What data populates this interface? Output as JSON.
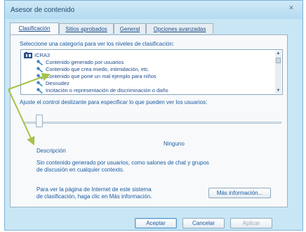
{
  "window": {
    "title": "Asesor de contenido",
    "close_label": "✕"
  },
  "tabs": [
    {
      "label": "Clasificación",
      "active": true
    },
    {
      "label": "Sitios aprobados",
      "active": false
    },
    {
      "label": "General",
      "active": false
    },
    {
      "label": "Opciones avanzadas",
      "active": false
    }
  ],
  "panel": {
    "category_prompt": "Seleccione una categoría para ver los niveles de clasificación:",
    "tree": {
      "root": "ICRA3",
      "items": [
        "Contenido generado por usuarios",
        "Contenido que crea miedo, intimidación, etc.",
        "Contenido que pone un mal ejemplo para niños",
        "Desnudez",
        "Incitación o representación de discriminación o daño"
      ]
    },
    "slider_prompt": "Ajuste el control deslizante para especificar lo que pueden ver los usuarios:",
    "slider_value_label": "Ninguno",
    "description_heading": "Descripción",
    "description_text_1": "Sin contenido generado por usuarios, como salones de chat y grupos",
    "description_text_2": "de discusión en cualquier contexto.",
    "info_text_1": "Para ver la página de Internet de este sistema",
    "info_text_2": "de clasificación, haga clic en Más información.",
    "more_info_button": "Más información..."
  },
  "footer": {
    "accept_button": "Aceptar",
    "cancel_button": "Cancelar",
    "apply_button": "Aplicar"
  },
  "colors": {
    "accent": "#1c5ca0",
    "annotation_arrow": "#a6c24a"
  }
}
